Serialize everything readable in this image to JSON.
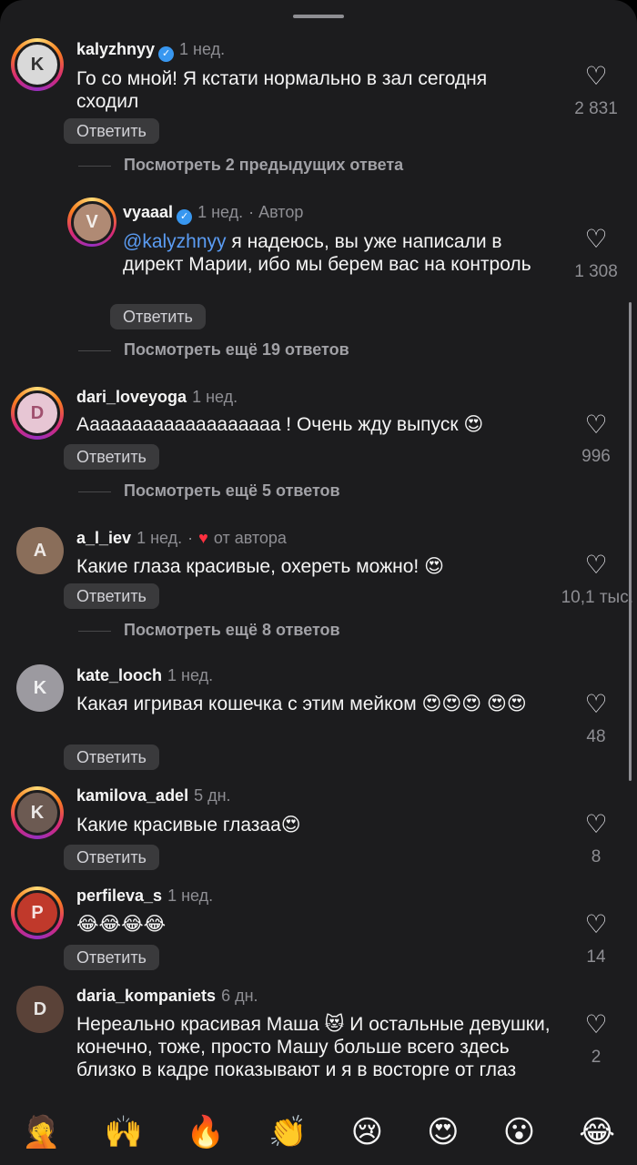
{
  "comments": [
    {
      "username": "kalyzhnyy",
      "verified": true,
      "time": "1 нед.",
      "text": "Го со мной! Я кстати нормально в зал сегодня сходил",
      "likes": "2 831",
      "reply_label": "Ответить",
      "avatar_initial": "K",
      "avatar_color": "#d9d9d9"
    },
    {
      "username": "vyaaal",
      "verified": true,
      "time": "1 нед.",
      "author_tag": "· Автор",
      "mention": "@kalyzhnyy",
      "text": " я надеюсь, вы уже написали в директ Марии, ибо мы берем вас на контроль",
      "likes": "1 308",
      "reply_label": "Ответить",
      "avatar_initial": "V",
      "avatar_color": "#b08a74"
    },
    {
      "username": "dari_loveyoga",
      "time": "1 нед.",
      "text": "Ааааааааааааааааааа ! Очень жду выпуск 😍",
      "likes": "996",
      "reply_label": "Ответить",
      "avatar_initial": "D",
      "avatar_color": "#e7c6d4"
    },
    {
      "username": "a_l_iev",
      "time": "1 нед.",
      "author_like": "от автора",
      "text": "Какие глаза красивые, охереть можно! 😍",
      "likes": "10,1 тыс.",
      "reply_label": "Ответить",
      "avatar_initial": "A",
      "avatar_color": "#8a6e5a"
    },
    {
      "username": "kate_looch",
      "time": "1 нед.",
      "text": "Какая игривая кошечка с этим мейком 😍😍😍 😍😍",
      "likes": "48",
      "reply_label": "Ответить",
      "avatar_initial": "K",
      "avatar_color": "#9c9aa0"
    },
    {
      "username": "kamilova_adel",
      "time": "5 дн.",
      "text": "Какие красивые глазаа😍",
      "likes": "8",
      "reply_label": "Ответить",
      "avatar_initial": "K",
      "avatar_color": "#6c5a52"
    },
    {
      "username": "perfileva_s",
      "time": "1 нед.",
      "text": "😂😂😂😂",
      "likes": "14",
      "reply_label": "Ответить",
      "avatar_initial": "P",
      "avatar_color": "#c0392b"
    },
    {
      "username": "daria_kompaniets",
      "time": "6 дн.",
      "text": "Нереально красивая Маша 😻 И остальные девушки, конечно, тоже, просто Машу больше всего здесь близко в кадре показывают и я в восторге от глаз",
      "likes": "2",
      "avatar_initial": "D",
      "avatar_color": "#5a4238"
    }
  ],
  "more_replies": [
    "Посмотреть 2 предыдущих ответа",
    "Посмотреть ещё 19 ответов",
    "Посмотреть ещё 5 ответов",
    "Посмотреть ещё 8 ответов"
  ],
  "emoji_bar": [
    "🤦",
    "🙌",
    "🔥",
    "👏",
    "😢",
    "😍",
    "😮",
    "😂"
  ],
  "icons": {
    "like": "heart-outline-icon",
    "verified": "verified-badge-icon",
    "author_like": "red-heart-icon"
  }
}
